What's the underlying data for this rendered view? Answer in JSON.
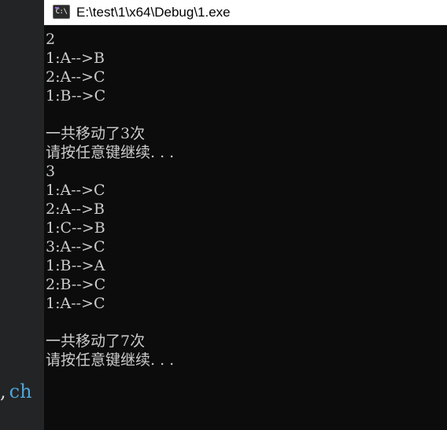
{
  "background_editor": {
    "fragment_comma": ",",
    "fragment_text": "ch"
  },
  "console": {
    "title": "E:\\test\\1\\x64\\Debug\\1.exe",
    "icon": {
      "name": "console-app-icon",
      "glyph": "C:\\"
    },
    "lines": [
      "2",
      "1:A-->B",
      "2:A-->C",
      "1:B-->C",
      "",
      "一共移动了3次",
      "请按任意键继续. . .",
      "3",
      "1:A-->C",
      "2:A-->B",
      "1:C-->B",
      "3:A-->C",
      "1:B-->A",
      "2:B-->C",
      "1:A-->C",
      "",
      "一共移动了7次",
      "请按任意键继续. . ."
    ]
  },
  "colors": {
    "console_bg": "#0c0c0c",
    "console_text": "#cccccc",
    "titlebar_bg": "#ffffff",
    "editor_bg": "#232425",
    "keyword_blue": "#4ea5d9"
  }
}
